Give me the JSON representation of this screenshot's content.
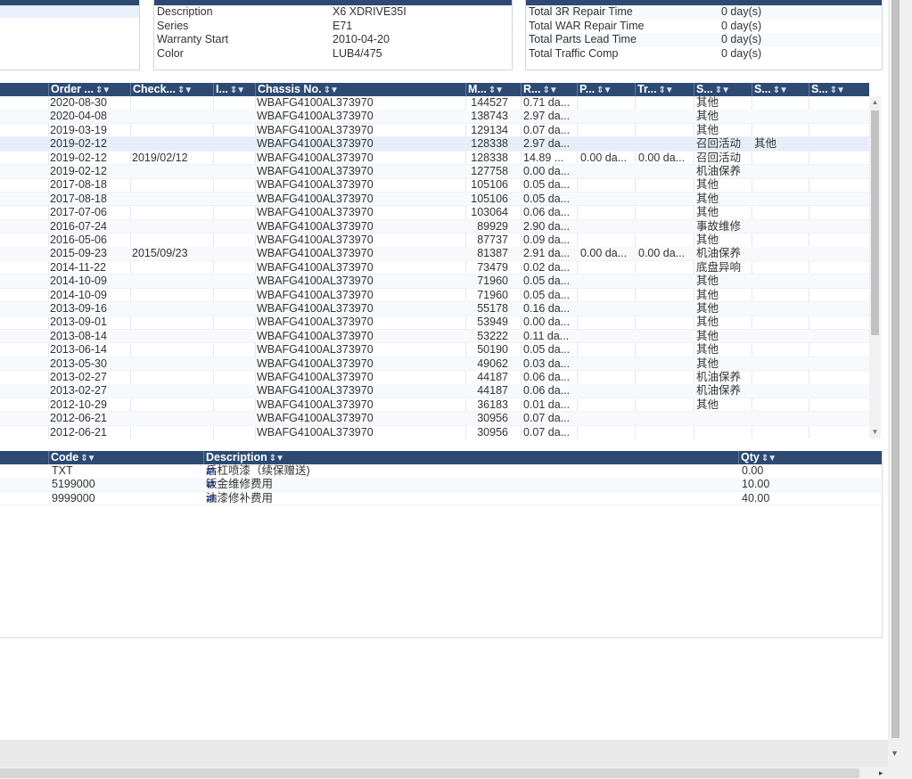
{
  "vehicle": {
    "rows": [
      {
        "label": "Description",
        "value": "X6 XDRIVE35I"
      },
      {
        "label": "Series",
        "value": "E71"
      },
      {
        "label": "Warranty Start",
        "value": "2010-04-20"
      },
      {
        "label": "Color",
        "value": "LUB4/475"
      }
    ]
  },
  "totals": {
    "rows": [
      {
        "label": "Total 3R Repair Time",
        "value": "0 day(s)"
      },
      {
        "label": "Total WAR Repair Time",
        "value": "0 day(s)"
      },
      {
        "label": "Total Parts Lead Time",
        "value": "0 day(s)"
      },
      {
        "label": "Total Traffic Comp",
        "value": "0 day(s)"
      }
    ]
  },
  "orders": {
    "columns": [
      "Order ...",
      "Check...",
      "I...",
      "Chassis No.",
      "M...",
      "R...",
      "P...",
      "Tr...",
      "S...",
      "S...",
      "S..."
    ],
    "rows": [
      [
        "2020-08-30",
        "",
        "",
        "WBAFG4100AL373970",
        "144527",
        "0.71 da...",
        "",
        "",
        "其他",
        ""
      ],
      [
        "2020-04-08",
        "",
        "",
        "WBAFG4100AL373970",
        "138743",
        "2.97 da...",
        "",
        "",
        "其他",
        ""
      ],
      [
        "2019-03-19",
        "",
        "",
        "WBAFG4100AL373970",
        "129134",
        "0.07 da...",
        "",
        "",
        "其他",
        ""
      ],
      [
        "2019-02-12",
        "",
        "",
        "WBAFG4100AL373970",
        "128338",
        "2.97 da...",
        "",
        "",
        "召回活动",
        "其他"
      ],
      [
        "2019-02-12",
        "2019/02/12",
        "",
        "WBAFG4100AL373970",
        "128338",
        "14.89 ...",
        "0.00 da...",
        "0.00 da...",
        "召回活动",
        ""
      ],
      [
        "2019-02-12",
        "",
        "",
        "WBAFG4100AL373970",
        "127758",
        "0.00 da...",
        "",
        "",
        "机油保养",
        ""
      ],
      [
        "2017-08-18",
        "",
        "",
        "WBAFG4100AL373970",
        "105106",
        "0.05 da...",
        "",
        "",
        "其他",
        ""
      ],
      [
        "2017-08-18",
        "",
        "",
        "WBAFG4100AL373970",
        "105106",
        "0.05 da...",
        "",
        "",
        "其他",
        ""
      ],
      [
        "2017-07-06",
        "",
        "",
        "WBAFG4100AL373970",
        "103064",
        "0.06 da...",
        "",
        "",
        "其他",
        ""
      ],
      [
        "2016-07-24",
        "",
        "",
        "WBAFG4100AL373970",
        "89929",
        "2.90 da...",
        "",
        "",
        "事故维修",
        ""
      ],
      [
        "2016-05-06",
        "",
        "",
        "WBAFG4100AL373970",
        "87737",
        "0.09 da...",
        "",
        "",
        "其他",
        ""
      ],
      [
        "2015-09-23",
        "2015/09/23",
        "",
        "WBAFG4100AL373970",
        "81387",
        "2.91 da...",
        "0.00 da...",
        "0.00 da...",
        "机油保养",
        ""
      ],
      [
        "2014-11-22",
        "",
        "",
        "WBAFG4100AL373970",
        "73479",
        "0.02 da...",
        "",
        "",
        "底盘异响",
        ""
      ],
      [
        "2014-10-09",
        "",
        "",
        "WBAFG4100AL373970",
        "71960",
        "0.05 da...",
        "",
        "",
        "其他",
        ""
      ],
      [
        "2014-10-09",
        "",
        "",
        "WBAFG4100AL373970",
        "71960",
        "0.05 da...",
        "",
        "",
        "其他",
        ""
      ],
      [
        "2013-09-16",
        "",
        "",
        "WBAFG4100AL373970",
        "55178",
        "0.16 da...",
        "",
        "",
        "其他",
        ""
      ],
      [
        "2013-09-01",
        "",
        "",
        "WBAFG4100AL373970",
        "53949",
        "0.00 da...",
        "",
        "",
        "其他",
        ""
      ],
      [
        "2013-08-14",
        "",
        "",
        "WBAFG4100AL373970",
        "53222",
        "0.11 da...",
        "",
        "",
        "其他",
        ""
      ],
      [
        "2013-06-14",
        "",
        "",
        "WBAFG4100AL373970",
        "50190",
        "0.05 da...",
        "",
        "",
        "其他",
        ""
      ],
      [
        "2013-05-30",
        "",
        "",
        "WBAFG4100AL373970",
        "49062",
        "0.03 da...",
        "",
        "",
        "其他",
        ""
      ],
      [
        "2013-02-27",
        "",
        "",
        "WBAFG4100AL373970",
        "44187",
        "0.06 da...",
        "",
        "",
        "机油保养",
        ""
      ],
      [
        "2013-02-27",
        "",
        "",
        "WBAFG4100AL373970",
        "44187",
        "0.06 da...",
        "",
        "",
        "机油保养",
        ""
      ],
      [
        "2012-10-29",
        "",
        "",
        "WBAFG4100AL373970",
        "36183",
        "0.01 da...",
        "",
        "",
        "其他",
        ""
      ],
      [
        "2012-06-21",
        "",
        "",
        "WBAFG4100AL373970",
        "30956",
        "0.07 da...",
        "",
        "",
        "",
        ""
      ],
      [
        "2012-06-21",
        "",
        "",
        "WBAFG4100AL373970",
        "30956",
        "0.07 da...",
        "",
        "",
        "",
        ""
      ]
    ]
  },
  "codes": {
    "columns": [
      "Code",
      "Description",
      "Qty"
    ],
    "swap_icon": "⇄",
    "rows": [
      [
        "TXT",
        "后杠喷漆（续保赠送)",
        "0.00"
      ],
      [
        "5199000",
        "钣金维修费用",
        "10.00"
      ],
      [
        "9999000",
        "油漆修补费用",
        "40.00"
      ]
    ]
  },
  "colors": {
    "header": "#2d4a73",
    "highlight": "#e6eefa",
    "swap_icon": "#1f4fd8"
  }
}
